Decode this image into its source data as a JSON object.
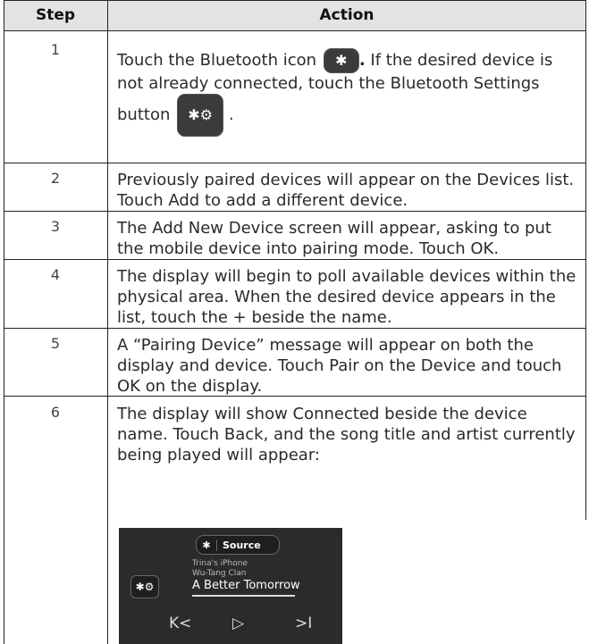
{
  "table": {
    "headers": [
      "Step",
      "Action"
    ],
    "rows": [
      {
        "step": "1",
        "action_pre": "Touch the Bluetooth icon",
        "action_mid": "If the desired device is not already connected, touch the Bluetooth Settings button",
        "action_end": "."
      },
      {
        "step": "2",
        "action": "Previously paired devices will appear on the Devices list.  Touch Add to add a different device."
      },
      {
        "step": "3",
        "action": "The Add New Device screen will appear, asking to put the mobile device into pairing mode.  Touch OK."
      },
      {
        "step": "4",
        "action": "The display will begin to poll available devices within the physical area.  When the desired device appears in the list, touch the + beside the name."
      },
      {
        "step": "5",
        "action": "A “Pairing Device” message will appear on both the display and device.  Touch Pair on the Device and touch OK on the display."
      },
      {
        "step": "6",
        "action": "The display will show Connected beside the device name.  Touch Back, and the song title and artist currently being played will appear:"
      }
    ]
  },
  "player": {
    "source_label": "Source",
    "device": "Trina's iPhone",
    "artist": "Wu-Tang Clan",
    "song": "A Better Tomorrow",
    "prev": "K<",
    "play": "▷",
    "next": ">I"
  },
  "icons": {
    "bluetooth": "bluetooth-icon",
    "settings": "gear-icon",
    "accent": "#3b3b3b"
  }
}
